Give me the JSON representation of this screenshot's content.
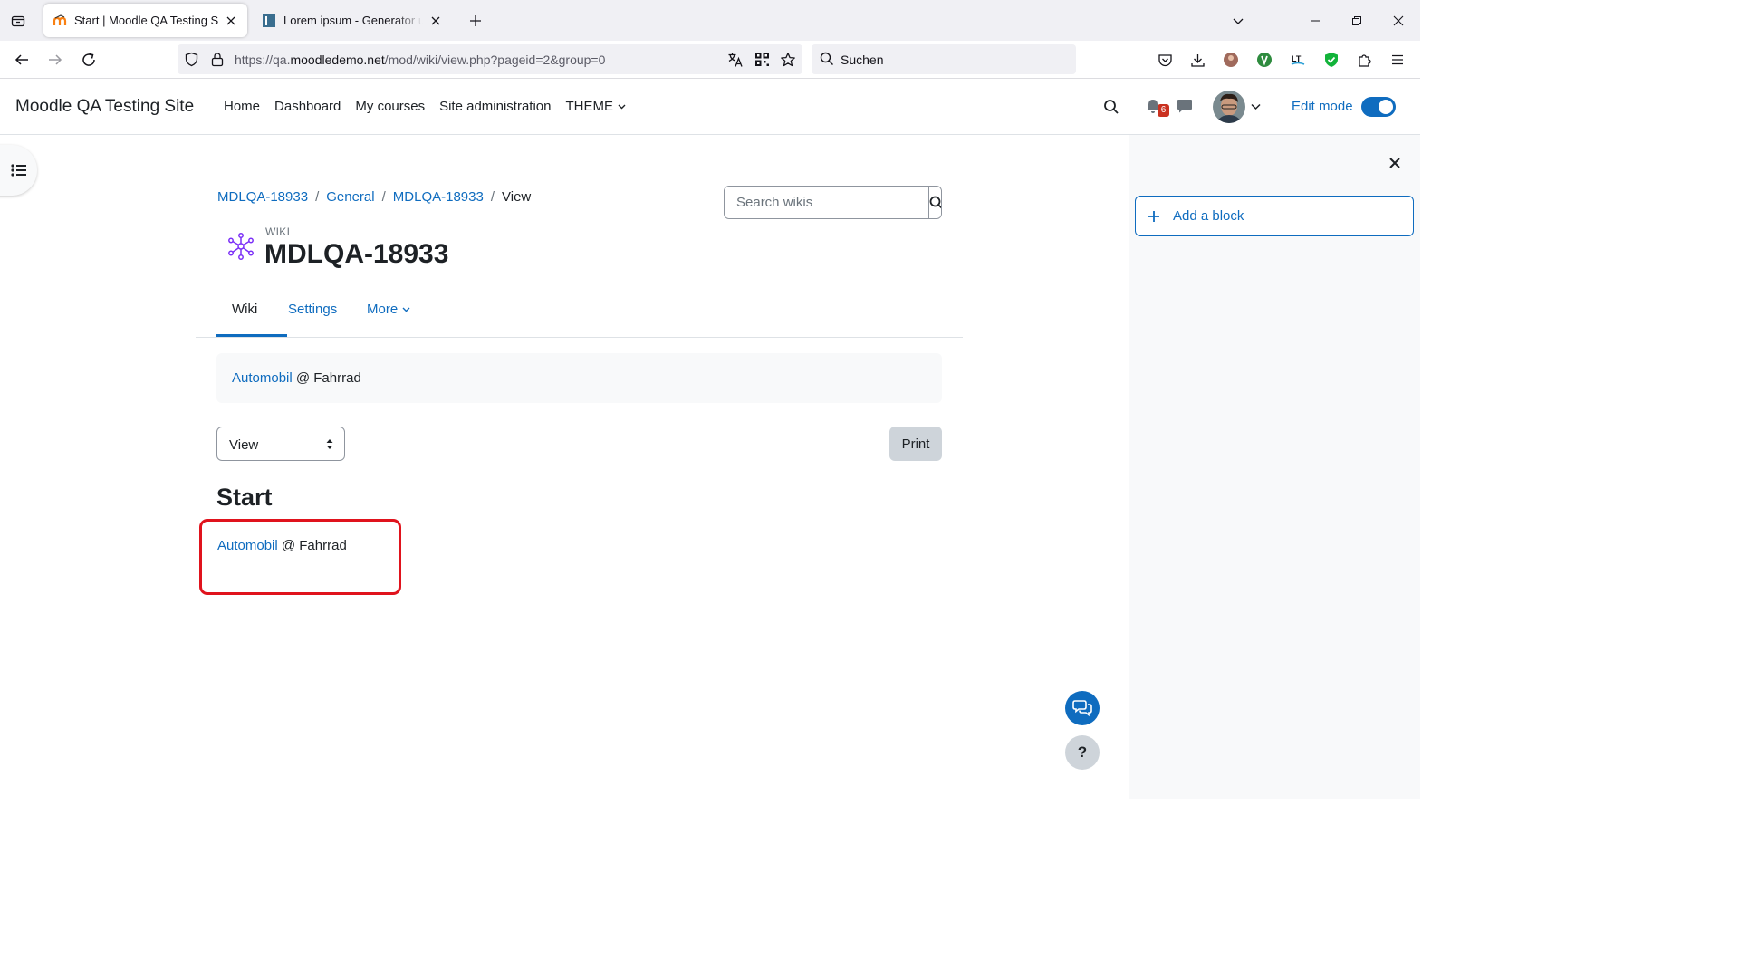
{
  "browser": {
    "tabs": [
      {
        "title": "Start | Moodle QA Testing Site",
        "active": true
      },
      {
        "title": "Lorem ipsum - Generator und Info",
        "active": false
      }
    ],
    "url_prefix": "https://qa.",
    "url_domain": "moodledemo.net",
    "url_path": "/mod/wiki/view.php?pageid=2&group=0",
    "search_placeholder": "Suchen"
  },
  "header": {
    "site_name": "Moodle QA Testing Site",
    "nav": [
      "Home",
      "Dashboard",
      "My courses",
      "Site administration",
      "THEME"
    ],
    "notification_count": "6",
    "edit_mode_label": "Edit mode",
    "edit_mode_on": true
  },
  "breadcrumb": {
    "items": [
      "MDLQA-18933",
      "General",
      "MDLQA-18933"
    ],
    "current": "View",
    "separator": "/"
  },
  "search": {
    "placeholder": "Search wikis"
  },
  "page": {
    "module_label": "WIKI",
    "title": "MDLQA-18933",
    "tabs": [
      "Wiki",
      "Settings",
      "More"
    ],
    "active_tab": "Wiki"
  },
  "nav_box": {
    "link": "Automobil",
    "rest": " @ Fahrrad"
  },
  "controls": {
    "view_select": "View",
    "print_label": "Print"
  },
  "wiki": {
    "heading": "Start",
    "link": "Automobil",
    "rest": " @ Fahrrad"
  },
  "drawer": {
    "add_block_label": "Add a block"
  },
  "help": {
    "label": "?"
  },
  "colors": {
    "link": "#0f6cbf",
    "annotation": "#e0131d",
    "wiki_icon": "#7b2ff7"
  }
}
